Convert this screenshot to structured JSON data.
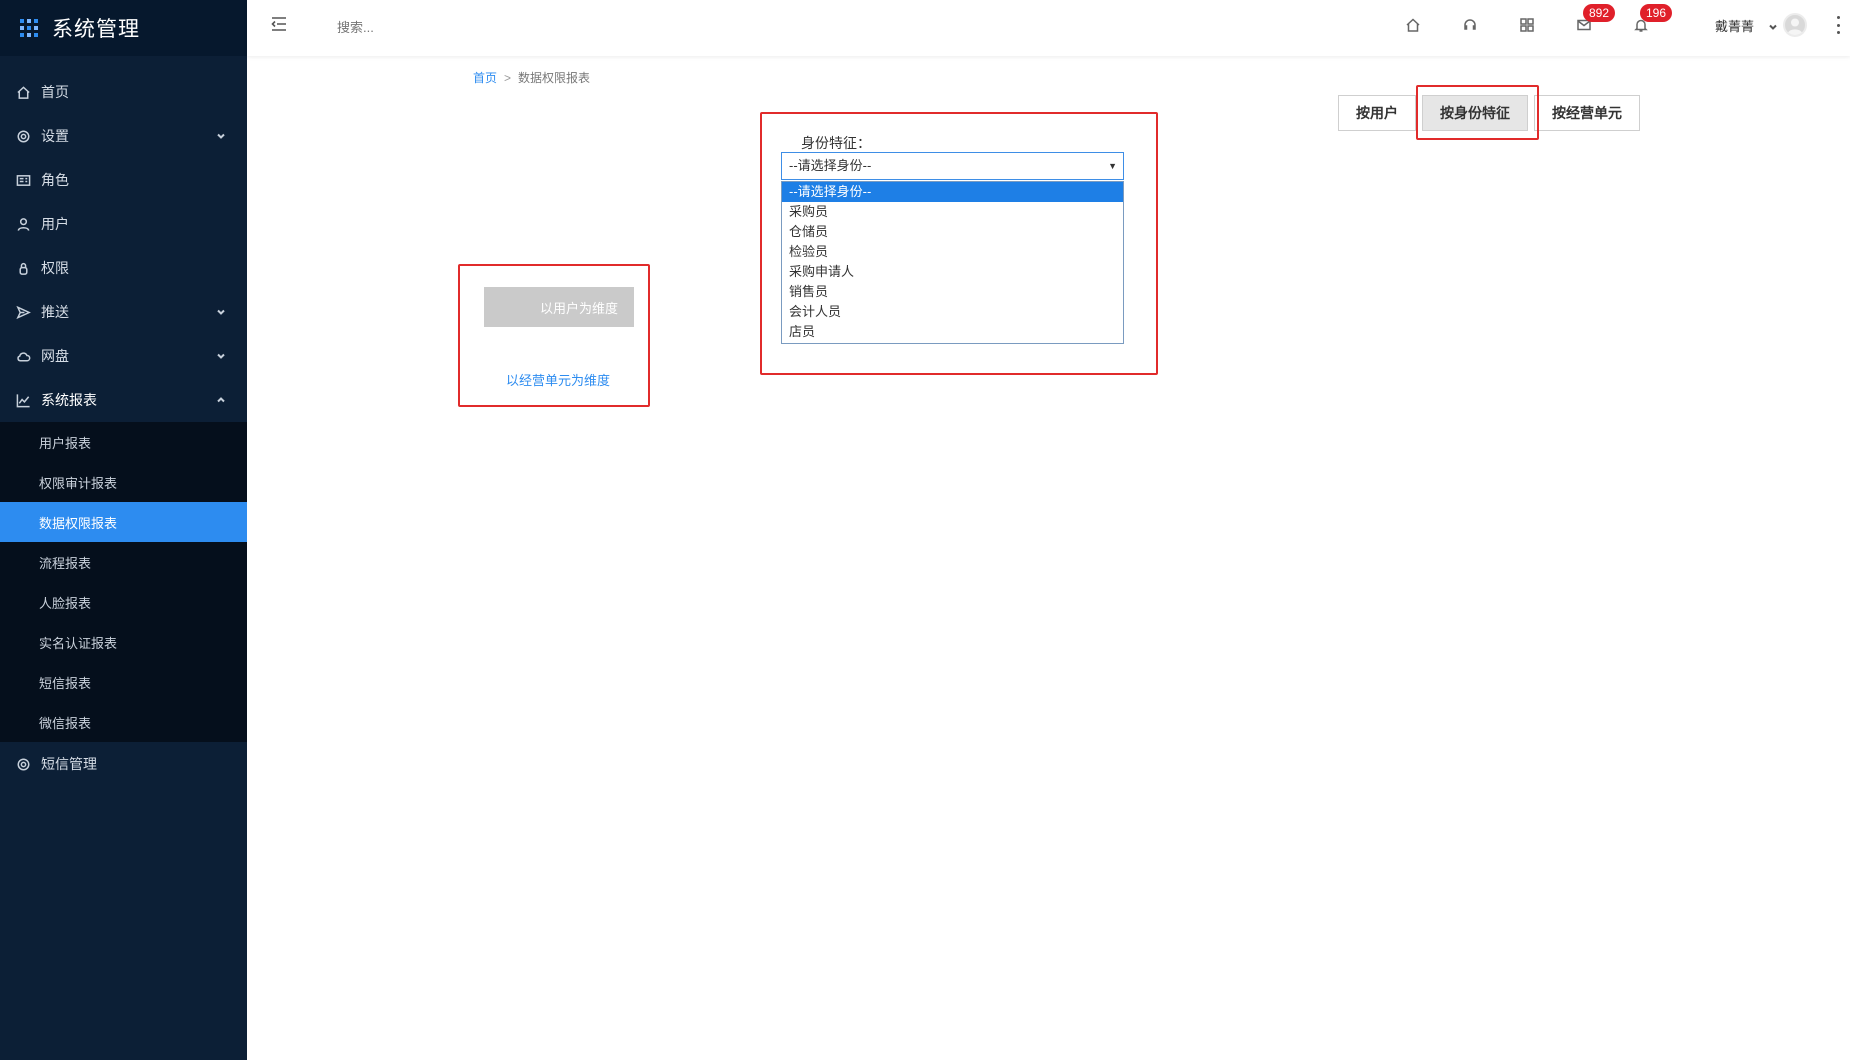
{
  "app": {
    "title": "系统管理"
  },
  "sidebar": {
    "items": [
      {
        "label": "首页",
        "icon": "home-icon"
      },
      {
        "label": "设置",
        "icon": "gear-icon"
      },
      {
        "label": "角色",
        "icon": "id-card-icon"
      },
      {
        "label": "用户",
        "icon": "user-icon"
      },
      {
        "label": "权限",
        "icon": "lock-icon"
      },
      {
        "label": "推送",
        "icon": "send-icon"
      },
      {
        "label": "网盘",
        "icon": "cloud-icon"
      },
      {
        "label": "系统报表",
        "icon": "chart-icon"
      },
      {
        "label": "短信管理",
        "icon": "gear-icon"
      }
    ],
    "submenu": [
      {
        "label": "用户报表"
      },
      {
        "label": "权限审计报表"
      },
      {
        "label": "数据权限报表",
        "active": true
      },
      {
        "label": "流程报表"
      },
      {
        "label": "人脸报表"
      },
      {
        "label": "实名认证报表"
      },
      {
        "label": "短信报表"
      },
      {
        "label": "微信报表"
      }
    ]
  },
  "header": {
    "search_placeholder": "搜索...",
    "messages_badge": "892",
    "notifications_badge": "196",
    "user_name": "戴菁菁"
  },
  "breadcrumb": {
    "home": "首页",
    "separator": ">",
    "current": "数据权限报表"
  },
  "tabs": {
    "by_user": "按用户",
    "by_identity": "按身份特征",
    "by_business_unit": "按经营单元"
  },
  "dimension": {
    "user_button": "以用户为维度",
    "unit_link": "以经营单元为维度"
  },
  "identity": {
    "label": "身份特征：",
    "selected": "--请选择身份--",
    "options": [
      "--请选择身份--",
      "采购员",
      "仓储员",
      "检验员",
      "采购申请人",
      "销售员",
      "会计人员",
      "店员"
    ]
  },
  "colors": {
    "accent": "#2d8cf0",
    "sidebar_bg": "#0c1f36",
    "highlight_box": "#e12b2b",
    "badge": "#e0202a"
  }
}
